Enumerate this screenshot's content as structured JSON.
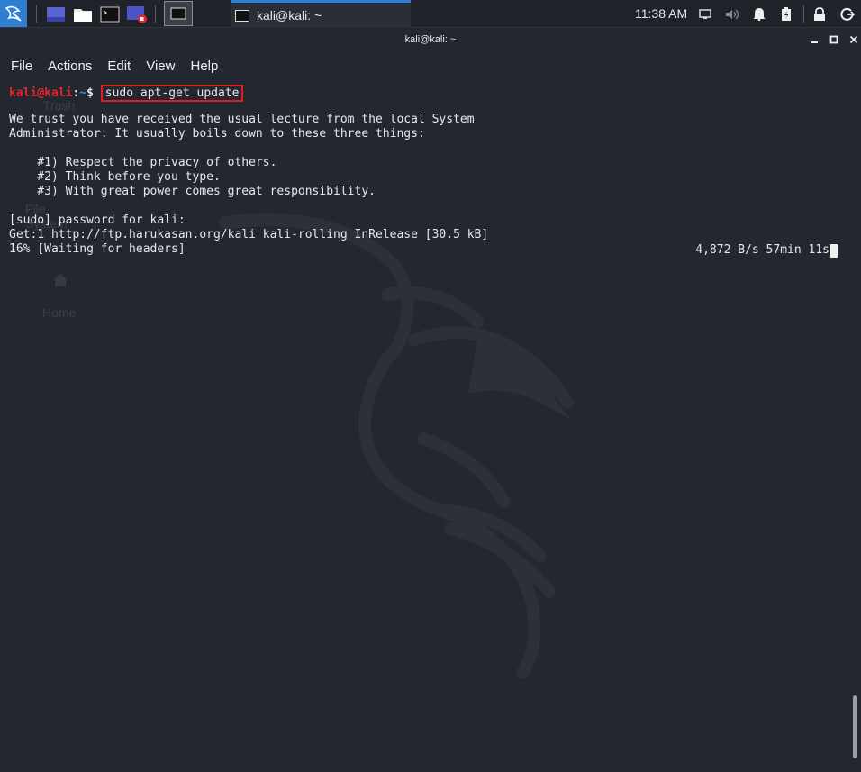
{
  "panel": {
    "task_title": "kali@kali: ~",
    "clock": "11:38 AM",
    "icons": [
      "kali-menu-icon",
      "workspace-icon",
      "file-manager-icon",
      "terminal-icon",
      "screen-recorder-icon",
      "window-switcher-icon",
      "display-icon",
      "volume-icon",
      "notification-icon",
      "battery-icon",
      "lock-icon",
      "logout-icon"
    ]
  },
  "window": {
    "title": "kali@kali: ~",
    "menu": [
      "File",
      "Actions",
      "Edit",
      "View",
      "Help"
    ]
  },
  "desktop_ghost": {
    "trash": "Trash",
    "filesystem": "File System",
    "home": "Home"
  },
  "terminal": {
    "prompt_user": "kali",
    "prompt_at": "@",
    "prompt_host": "kali",
    "prompt_sep": ":",
    "prompt_path": "~",
    "prompt_symbol": "$",
    "command": "sudo apt-get update",
    "lines": [
      "We trust you have received the usual lecture from the local System",
      "Administrator. It usually boils down to these three things:",
      "",
      "    #1) Respect the privacy of others.",
      "    #2) Think before you type.",
      "    #3) With great power comes great responsibility.",
      "",
      "[sudo] password for kali:",
      "Get:1 http://ftp.harukasan.org/kali kali-rolling InRelease [30.5 kB]",
      "16% [Waiting for headers]"
    ],
    "rate": "4,872 B/s 57min 11s"
  },
  "colors": {
    "prompt_red": "#e0262c",
    "prompt_blue": "#3c8fe0",
    "highlight_box": "#e31b23",
    "accent": "#2f7fd8"
  }
}
